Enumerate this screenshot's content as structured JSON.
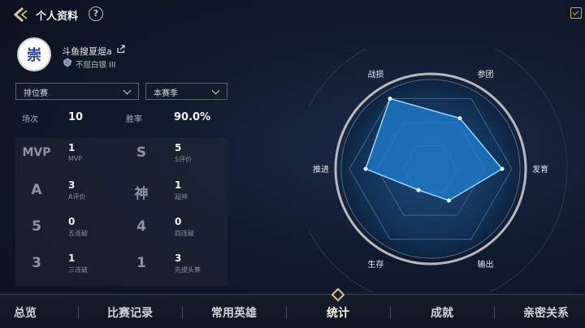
{
  "header": {
    "title": "个人资料",
    "help_label": "?"
  },
  "profile": {
    "avatar_glyph": "崇",
    "username": "斗鱼搜夏焜a",
    "rank": "不屈白银 III"
  },
  "filters": {
    "mode": "排位赛",
    "season": "本赛季"
  },
  "summary": {
    "matches_label": "场次",
    "matches_value": "10",
    "winrate_label": "胜率",
    "winrate_value": "90.0%"
  },
  "stats": [
    {
      "glyph": "MVP",
      "value": "1",
      "caption": "MVP"
    },
    {
      "glyph": "S",
      "value": "5",
      "caption": "S评价"
    },
    {
      "glyph": "A",
      "value": "3",
      "caption": "A评价"
    },
    {
      "glyph": "神",
      "value": "1",
      "caption": "超神"
    },
    {
      "glyph": "5",
      "value": "0",
      "caption": "五连破"
    },
    {
      "glyph": "4",
      "value": "0",
      "caption": "四连破"
    },
    {
      "glyph": "3",
      "value": "1",
      "caption": "三连破"
    },
    {
      "glyph": "1",
      "value": "3",
      "caption": "先拔头筹"
    }
  ],
  "radar": {
    "axes": [
      "战损",
      "参团",
      "发育",
      "输出",
      "生存",
      "推进"
    ],
    "values": [
      1.0,
      0.72,
      0.88,
      0.45,
      0.3,
      0.8
    ],
    "fill_color": "#1f7fd0",
    "stroke_color": "#8fd6ff"
  },
  "tabs": [
    "总览",
    "比赛记录",
    "常用英雄",
    "统计",
    "成就",
    "亲密关系"
  ],
  "active_tab": "统计",
  "colors": {
    "accent_gold": "#d9c58d"
  }
}
